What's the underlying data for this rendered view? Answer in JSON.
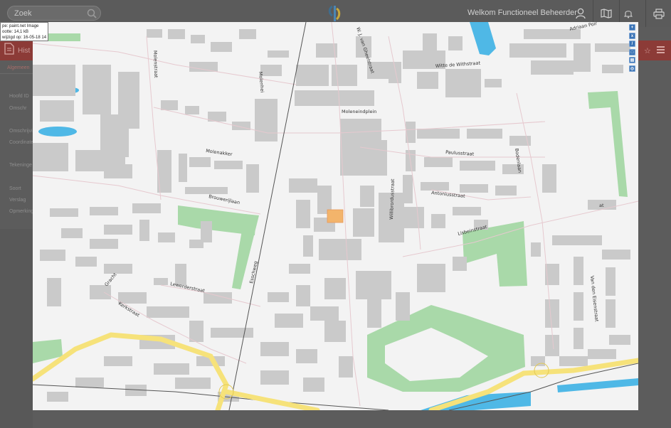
{
  "search": {
    "placeholder": "Zoek"
  },
  "header": {
    "welcome": "Welkom Functioneel Beheerder"
  },
  "tooltip": {
    "line1": "pe: paint.net Image",
    "line2": "ootte: 14,1 kB",
    "line3": "wijzigd op: 16-05-18 14:55"
  },
  "background_page": {
    "title": "Hist",
    "tab": "Algemeen",
    "fields": [
      "Hoofd ID",
      "Omschr",
      "Omschrijvi",
      "Coordinate",
      "Tekeninge",
      "Soort",
      "Verslag",
      "Opmerking"
    ]
  },
  "map_controls": [
    "+",
    "x",
    "/",
    "□",
    "▤",
    "◎"
  ],
  "streets": [
    "W. J. van Gheelstraat",
    "Adriaan Poir",
    "Witte de Withstraat",
    "Molenstraat",
    "Moleneindplein",
    "Molenakker",
    "Molenhei",
    "Paulusstraat",
    "Bodenlaan",
    "Antoniusstraat",
    "Willibrordusstraat",
    "Brouwerijlaan",
    "Lisbeinstraat",
    "Esschweg",
    "Gracht",
    "Lewerderstraat",
    "Kerkstraat",
    "Van den Eisenstraat",
    "at"
  ],
  "colors": {
    "topbar": "#5b5b5b",
    "accent_red": "#8c3b37",
    "road_major": "#f6e27a",
    "water": "#4fb8e6",
    "green": "#a8d8a8",
    "building": "#c9c9c9",
    "highlight": "#f3b46b"
  }
}
